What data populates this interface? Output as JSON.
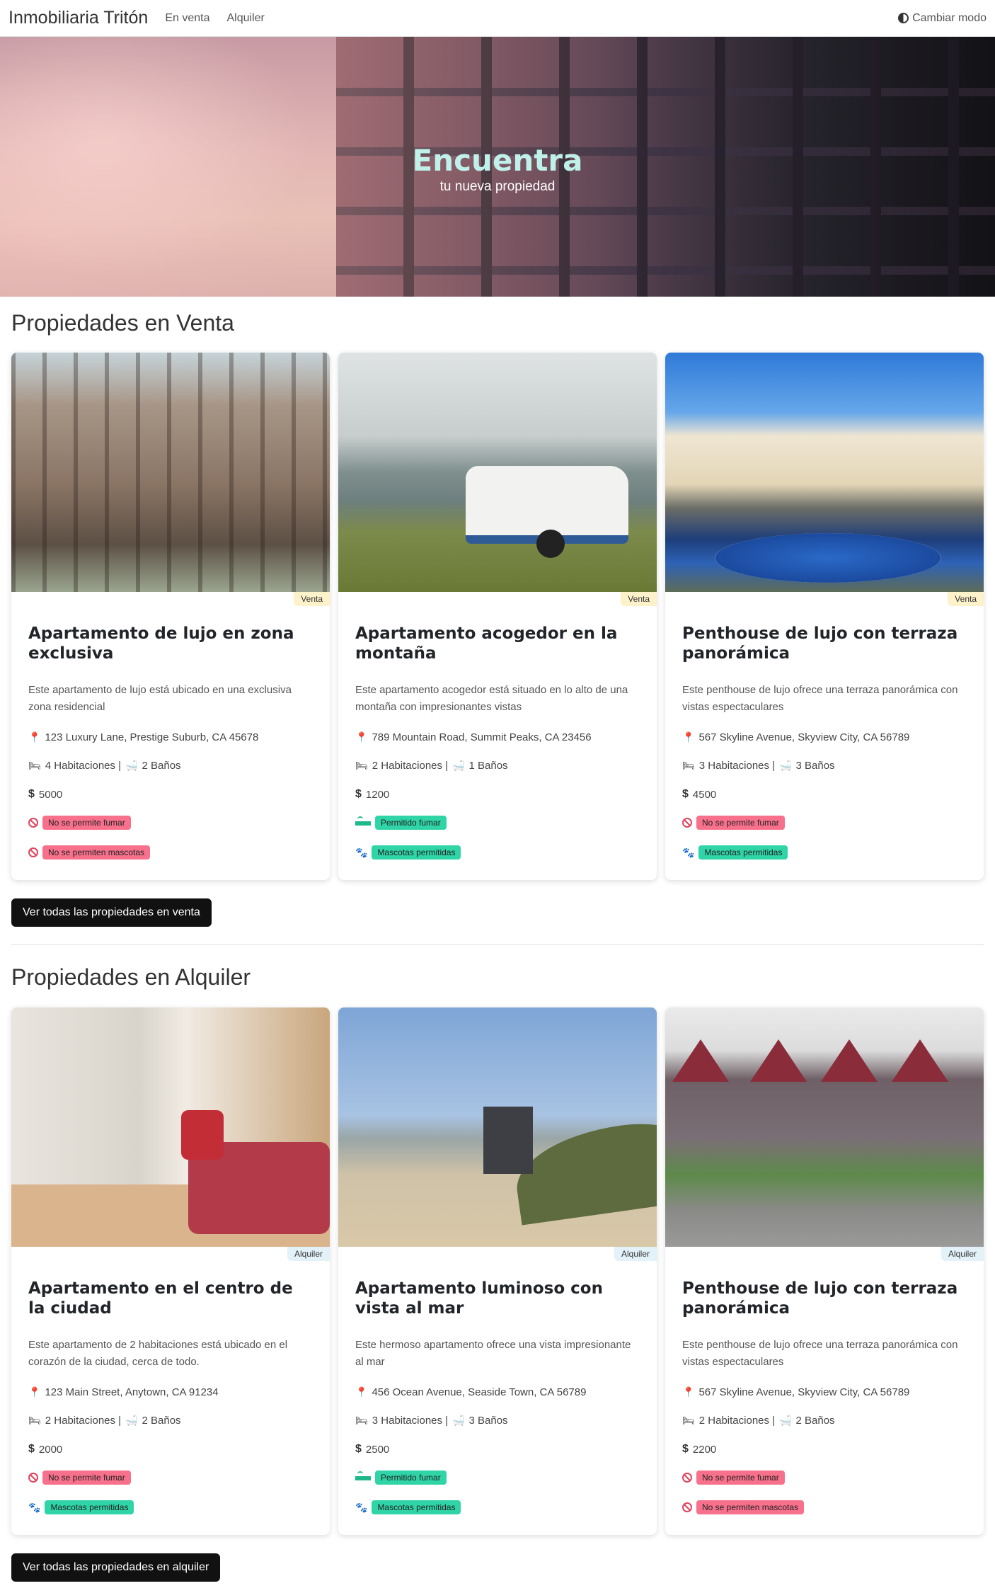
{
  "nav": {
    "brand": "Inmobiliaria Tritón",
    "links": [
      "En venta",
      "Alquiler"
    ],
    "toggle_label": "Cambiar modo"
  },
  "hero": {
    "title": "Encuentra",
    "subtitle": "tu nueva propiedad"
  },
  "sale": {
    "heading": "Propiedades en Venta",
    "button": "Ver todas las propiedades en venta",
    "cards": [
      {
        "badge": "Venta",
        "title": "Apartamento de lujo en zona exclusiva",
        "description": "Este apartamento de lujo está ubicado en una exclusiva zona residencial",
        "address": "123 Luxury Lane, Prestige Suburb, CA 45678",
        "rooms": "4 Habitaciones | ",
        "baths": "2 Baños",
        "price": "5000",
        "smoke": "No se permite fumar",
        "smoke_allowed": false,
        "pets": "No se permiten mascotas",
        "pets_allowed": false
      },
      {
        "badge": "Venta",
        "title": "Apartamento acogedor en la montaña",
        "description": "Este apartamento acogedor está situado en lo alto de una montaña con impresionantes vistas",
        "address": "789 Mountain Road, Summit Peaks, CA 23456",
        "rooms": "2 Habitaciones | ",
        "baths": "1 Baños",
        "price": "1200",
        "smoke": "Permitido fumar",
        "smoke_allowed": true,
        "pets": "Mascotas permitidas",
        "pets_allowed": true
      },
      {
        "badge": "Venta",
        "title": "Penthouse de lujo con terraza panorámica",
        "description": "Este penthouse de lujo ofrece una terraza panorámica con vistas espectaculares",
        "address": "567 Skyline Avenue, Skyview City, CA 56789",
        "rooms": "3 Habitaciones | ",
        "baths": "3 Baños",
        "price": "4500",
        "smoke": "No se permite fumar",
        "smoke_allowed": false,
        "pets": "Mascotas permitidas",
        "pets_allowed": true
      }
    ]
  },
  "rent": {
    "heading": "Propiedades en Alquiler",
    "button": "Ver todas las propiedades en alquiler",
    "cards": [
      {
        "badge": "Alquiler",
        "title": "Apartamento en el centro de la ciudad",
        "description": "Este apartamento de 2 habitaciones está ubicado en el corazón de la ciudad, cerca de todo.",
        "address": "123 Main Street, Anytown, CA 91234",
        "rooms": "2 Habitaciones | ",
        "baths": "2 Baños",
        "price": "2000",
        "smoke": "No se permite fumar",
        "smoke_allowed": false,
        "pets": "Mascotas permitidas",
        "pets_allowed": true
      },
      {
        "badge": "Alquiler",
        "title": "Apartamento luminoso con vista al mar",
        "description": "Este hermoso apartamento ofrece una vista impresionante al mar",
        "address": "456 Ocean Avenue, Seaside Town, CA 56789",
        "rooms": "3 Habitaciones | ",
        "baths": "3 Baños",
        "price": "2500",
        "smoke": "Permitido fumar",
        "smoke_allowed": true,
        "pets": "Mascotas permitidas",
        "pets_allowed": true
      },
      {
        "badge": "Alquiler",
        "title": "Penthouse de lujo con terraza panorámica",
        "description": "Este penthouse de lujo ofrece una terraza panorámica con vistas espectaculares",
        "address": "567 Skyline Avenue, Skyview City, CA 56789",
        "rooms": "2 Habitaciones | ",
        "baths": "2 Baños",
        "price": "2200",
        "smoke": "No se permite fumar",
        "smoke_allowed": false,
        "pets": "No se permiten mascotas",
        "pets_allowed": false
      }
    ]
  },
  "colors": {
    "hero_title": "#bff0ea",
    "not_allowed": "#f7708c",
    "allowed": "#2fd4a7",
    "button": "#111111"
  }
}
